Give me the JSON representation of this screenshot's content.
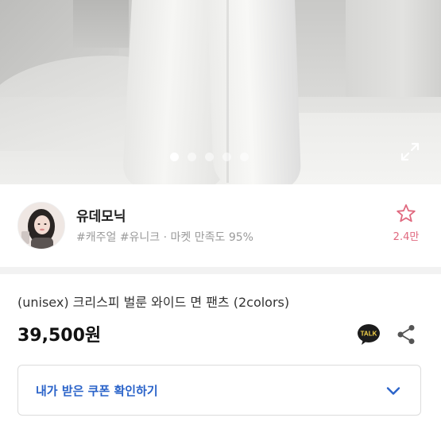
{
  "gallery": {
    "image_count": 5,
    "active_index": 0,
    "expand_icon": "fullscreen-expand-icon"
  },
  "seller": {
    "name": "유데모닉",
    "tags": "#캐주얼 #유니크 · 마켓 만족도 95%",
    "avatar_icon": "seller-avatar",
    "favorite": {
      "icon": "star-outline-icon",
      "count": "2.4만",
      "color": "#e0697f"
    }
  },
  "product": {
    "title": "(unisex) 크리스피 벌룬 와이드 면 팬츠 (2colors)",
    "price": "39,500원",
    "talk_icon": "kakao-talk-icon",
    "talk_label": "TALK",
    "share_icon": "share-icon"
  },
  "coupon": {
    "label": "내가 받은 쿠폰 확인하기",
    "color": "#2a63c9",
    "chevron_icon": "chevron-down-icon"
  }
}
